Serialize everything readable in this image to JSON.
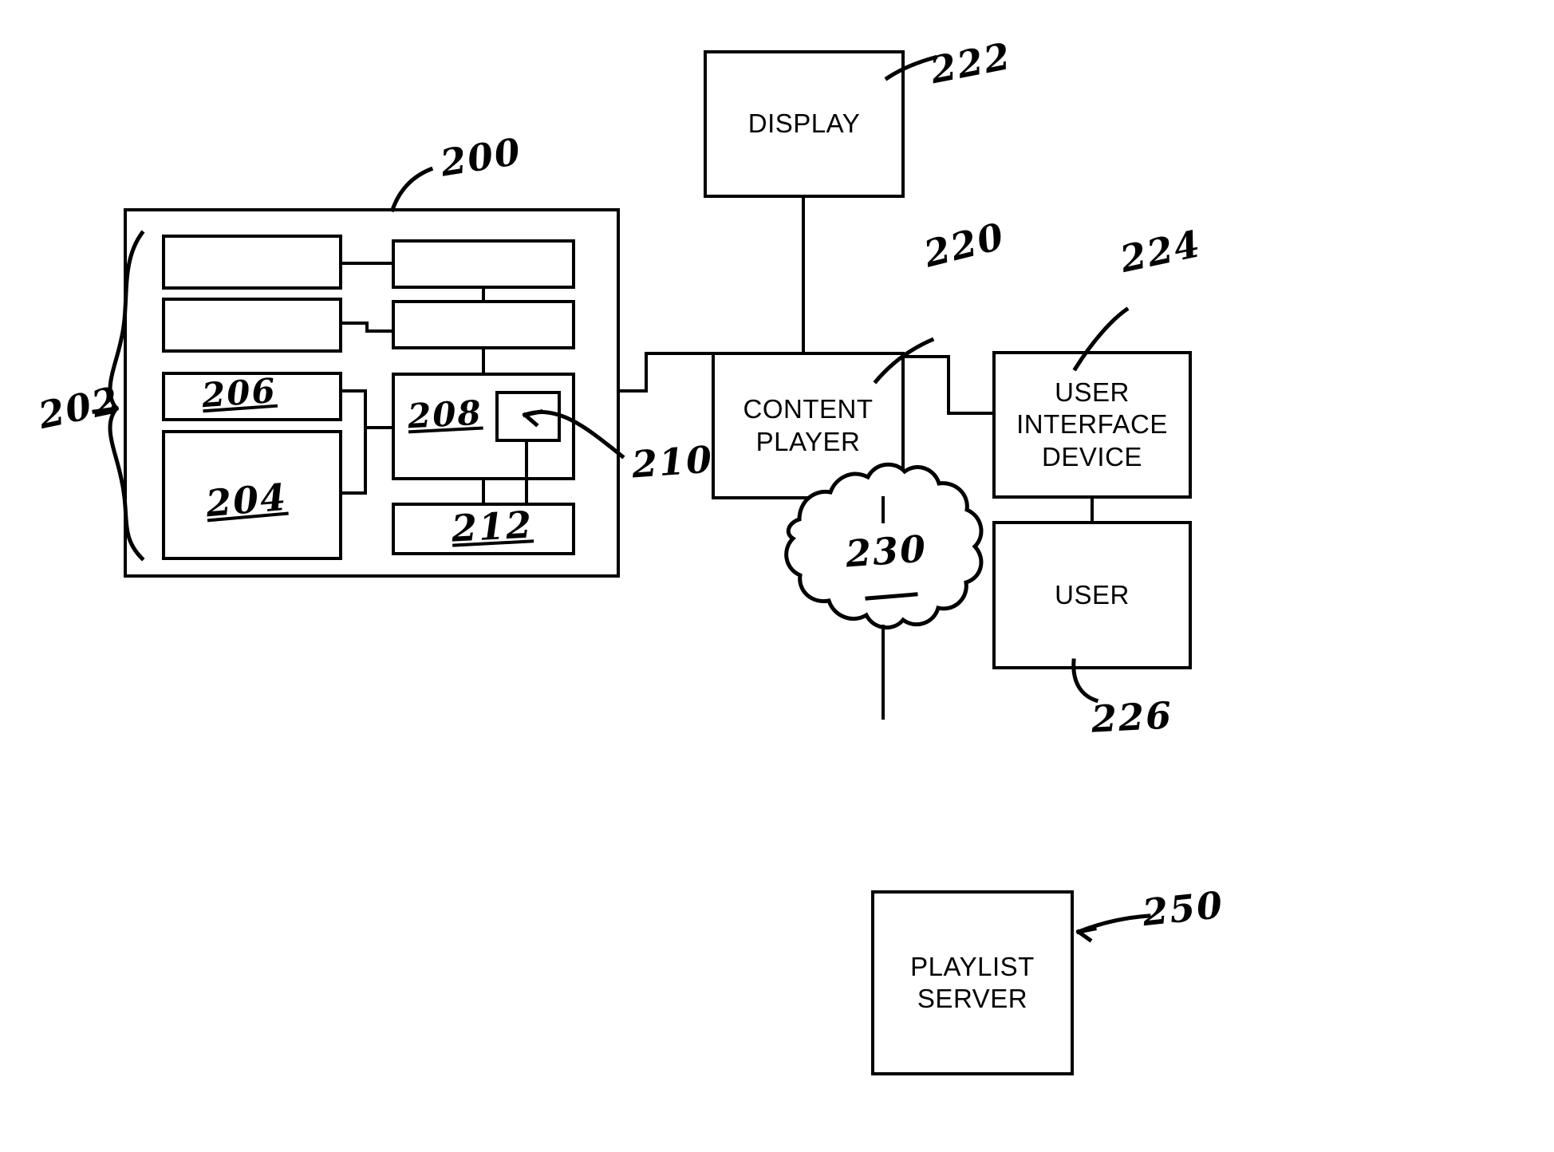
{
  "figure": {
    "type": "patent-block-diagram",
    "description": "Content player system block diagram with handwritten reference numerals"
  },
  "blocks": {
    "outer_system": {
      "ref": "200",
      "label": ""
    },
    "module_group": {
      "ref": "202",
      "label": ""
    },
    "box_top_left": {
      "ref": "",
      "label": ""
    },
    "box_mid_left": {
      "ref": "",
      "label": ""
    },
    "box_206": {
      "ref": "206",
      "label": ""
    },
    "box_204": {
      "ref": "204",
      "label": ""
    },
    "box_top_right": {
      "ref": "",
      "label": ""
    },
    "box_mid_right": {
      "ref": "",
      "label": ""
    },
    "box_208": {
      "ref": "208",
      "label": ""
    },
    "box_210": {
      "ref": "210",
      "label": ""
    },
    "box_212": {
      "ref": "212",
      "label": ""
    },
    "display": {
      "ref": "222",
      "label": "DISPLAY"
    },
    "content_player": {
      "ref": "220",
      "label": "CONTENT\nPLAYER"
    },
    "user_interface_device": {
      "ref": "224",
      "label": "USER\nINTERFACE\nDEVICE"
    },
    "user": {
      "ref": "226",
      "label": "USER"
    },
    "network_cloud": {
      "ref": "230",
      "label": ""
    },
    "playlist_server": {
      "ref": "250",
      "label": "PLAYLIST\nSERVER"
    }
  },
  "reference_numerals": {
    "n200": "200",
    "n202": "202",
    "n204": "204",
    "n206": "206",
    "n208": "208",
    "n210": "210",
    "n212": "212",
    "n220": "220",
    "n222": "222",
    "n224": "224",
    "n226": "226",
    "n230": "230",
    "n250": "250"
  },
  "colors": {
    "ink": "#000000",
    "paper": "#ffffff"
  }
}
